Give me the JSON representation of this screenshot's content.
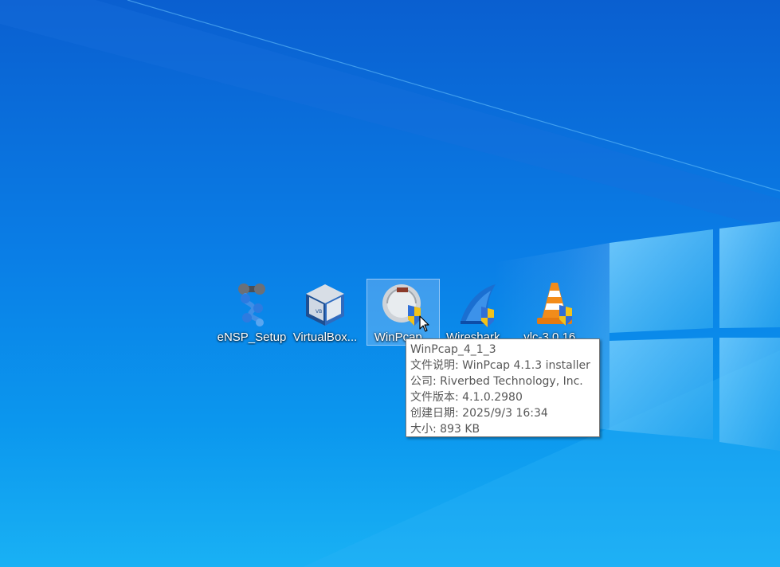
{
  "desktop": {
    "icons": [
      {
        "label": "eNSP_Setup",
        "icon": "ensp-setup-icon"
      },
      {
        "label": "VirtualBox...",
        "icon": "virtualbox-icon"
      },
      {
        "label": "WinPcap...",
        "icon": "winpcap-installer-icon",
        "selected": true
      },
      {
        "label": "Wireshark...",
        "icon": "wireshark-installer-icon"
      },
      {
        "label": "vlc-3.0.16...",
        "icon": "vlc-installer-icon"
      }
    ]
  },
  "tooltip": {
    "name": "WinPcap_4_1_3",
    "description": "文件说明: WinPcap 4.1.3 installer",
    "company": "公司: Riverbed Technology, Inc.",
    "version": "文件版本: 4.1.0.2980",
    "created": "创建日期: 2025/9/3 16:34",
    "size": "大小: 893 KB"
  },
  "colors": {
    "wallpaper_top": "#0a5fd0",
    "wallpaper_bottom": "#19b1f4",
    "uac_shield_blue": "#2f6fd6",
    "uac_shield_yellow": "#f2c21a"
  }
}
